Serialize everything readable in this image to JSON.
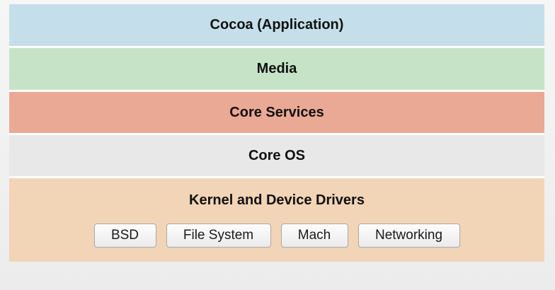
{
  "diagram": {
    "layers": [
      {
        "label": "Cocoa (Application)",
        "color": "#c5dfea"
      },
      {
        "label": "Media",
        "color": "#c6e3c7"
      },
      {
        "label": "Core Services",
        "color": "#eaa995"
      },
      {
        "label": "Core OS",
        "color": "#e7e8e7"
      }
    ],
    "kernel": {
      "label": "Kernel and Device Drivers",
      "color": "#f2d4b6",
      "modules": [
        {
          "label": "BSD"
        },
        {
          "label": "File System"
        },
        {
          "label": "Mach"
        },
        {
          "label": "Networking"
        }
      ]
    }
  }
}
